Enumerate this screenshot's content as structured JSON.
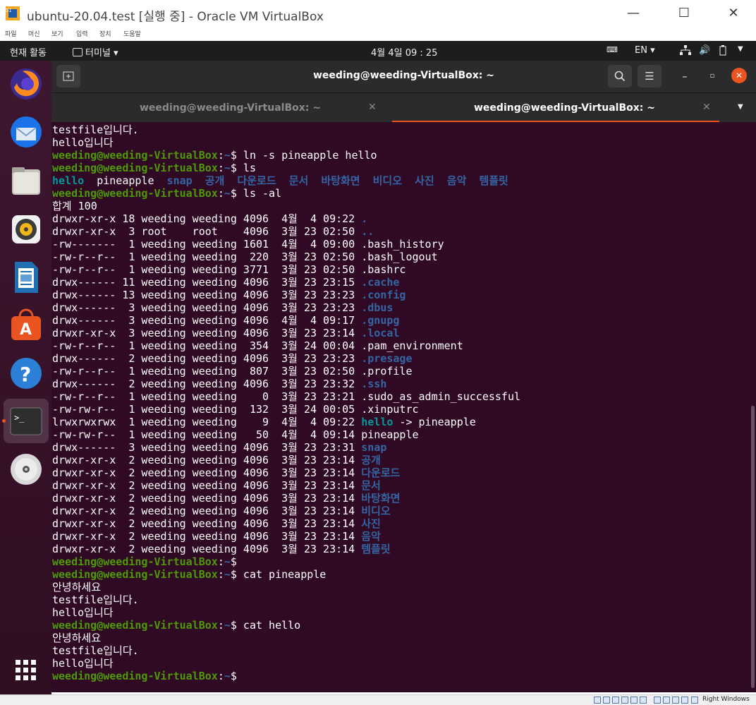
{
  "vbox": {
    "title": "ubuntu-20.04.test [실행 중] - Oracle VM VirtualBox",
    "menu": [
      "파일",
      "머신",
      "보기",
      "입력",
      "장치",
      "도움말"
    ],
    "host_key": "Right Windows"
  },
  "topbar": {
    "activities": "현재 활동",
    "app": "터미널 ▾",
    "clock": "4월 4일  09 : 25",
    "lang": "EN ▾"
  },
  "terminal": {
    "title": "weeding@weeding-VirtualBox: ~",
    "tabs": [
      {
        "label": "weeding@weeding-VirtualBox: ~"
      },
      {
        "label": "weeding@weeding-VirtualBox: ~"
      }
    ],
    "prompt_user": "weeding@weeding-VirtualBox",
    "lines": [
      {
        "t": "testfile입니다."
      },
      {
        "t": "hello입니다"
      },
      {
        "cmd": "ln -s pineapple hello"
      },
      {
        "cmd": "ls"
      },
      {
        "ls": true
      },
      {
        "cmd": "ls -al"
      },
      {
        "t": "합계 100"
      },
      {
        "pre": "drwxr-xr-x 18 weeding weeding 4096  4월  4 09:22 ",
        "name": ".",
        "c": "d"
      },
      {
        "pre": "drwxr-xr-x  3 root    root    4096  3월 23 02:50 ",
        "name": "..",
        "c": "d"
      },
      {
        "pre": "-rw-------  1 weeding weeding 1601  4월  4 09:00 ",
        "name": ".bash_history",
        "c": "p"
      },
      {
        "pre": "-rw-r--r--  1 weeding weeding  220  3월 23 02:50 ",
        "name": ".bash_logout",
        "c": "p"
      },
      {
        "pre": "-rw-r--r--  1 weeding weeding 3771  3월 23 02:50 ",
        "name": ".bashrc",
        "c": "p"
      },
      {
        "pre": "drwx------ 11 weeding weeding 4096  3월 23 23:15 ",
        "name": ".cache",
        "c": "d"
      },
      {
        "pre": "drwx------ 13 weeding weeding 4096  3월 23 23:23 ",
        "name": ".config",
        "c": "d"
      },
      {
        "pre": "drwx------  3 weeding weeding 4096  3월 23 23:23 ",
        "name": ".dbus",
        "c": "d"
      },
      {
        "pre": "drwx------  3 weeding weeding 4096  4월  4 09:17 ",
        "name": ".gnupg",
        "c": "d"
      },
      {
        "pre": "drwxr-xr-x  3 weeding weeding 4096  3월 23 23:14 ",
        "name": ".local",
        "c": "d"
      },
      {
        "pre": "-rw-r--r--  1 weeding weeding  354  3월 24 00:04 ",
        "name": ".pam_environment",
        "c": "p"
      },
      {
        "pre": "drwx------  2 weeding weeding 4096  3월 23 23:23 ",
        "name": ".presage",
        "c": "d"
      },
      {
        "pre": "-rw-r--r--  1 weeding weeding  807  3월 23 02:50 ",
        "name": ".profile",
        "c": "p"
      },
      {
        "pre": "drwx------  2 weeding weeding 4096  3월 23 23:32 ",
        "name": ".ssh",
        "c": "d"
      },
      {
        "pre": "-rw-r--r--  1 weeding weeding    0  3월 23 23:21 ",
        "name": ".sudo_as_admin_successful",
        "c": "p"
      },
      {
        "pre": "-rw-rw-r--  1 weeding weeding  132  3월 24 00:05 ",
        "name": ".xinputrc",
        "c": "p"
      },
      {
        "pre": "lrwxrwxrwx  1 weeding weeding    9  4월  4 09:22 ",
        "name": "hello",
        "c": "l",
        "target": " -> pineapple"
      },
      {
        "pre": "-rw-rw-r--  1 weeding weeding   50  4월  4 09:14 ",
        "name": "pineapple",
        "c": "p"
      },
      {
        "pre": "drwx------  3 weeding weeding 4096  3월 23 23:31 ",
        "name": "snap",
        "c": "d"
      },
      {
        "pre": "drwxr-xr-x  2 weeding weeding 4096  3월 23 23:14 ",
        "name": "공개",
        "c": "d"
      },
      {
        "pre": "drwxr-xr-x  2 weeding weeding 4096  3월 23 23:14 ",
        "name": "다운로드",
        "c": "d"
      },
      {
        "pre": "drwxr-xr-x  2 weeding weeding 4096  3월 23 23:14 ",
        "name": "문서",
        "c": "d"
      },
      {
        "pre": "drwxr-xr-x  2 weeding weeding 4096  3월 23 23:14 ",
        "name": "바탕화면",
        "c": "d"
      },
      {
        "pre": "drwxr-xr-x  2 weeding weeding 4096  3월 23 23:14 ",
        "name": "비디오",
        "c": "d"
      },
      {
        "pre": "drwxr-xr-x  2 weeding weeding 4096  3월 23 23:14 ",
        "name": "사진",
        "c": "d"
      },
      {
        "pre": "drwxr-xr-x  2 weeding weeding 4096  3월 23 23:14 ",
        "name": "음악",
        "c": "d"
      },
      {
        "pre": "drwxr-xr-x  2 weeding weeding 4096  3월 23 23:14 ",
        "name": "템플릿",
        "c": "d"
      },
      {
        "cmd": ""
      },
      {
        "cmd": "cat pineapple"
      },
      {
        "t": "안녕하세요"
      },
      {
        "t": "testfile입니다."
      },
      {
        "t": "hello입니다"
      },
      {
        "cmd": "cat hello"
      },
      {
        "t": "안녕하세요"
      },
      {
        "t": "testfile입니다."
      },
      {
        "t": "hello입니다"
      },
      {
        "cmd": ""
      }
    ],
    "ls_output": [
      {
        "name": "hello",
        "c": "l"
      },
      {
        "name": "pineapple",
        "c": "p"
      },
      {
        "name": "snap",
        "c": "d"
      },
      {
        "name": "공개",
        "c": "d"
      },
      {
        "name": "다운로드",
        "c": "d"
      },
      {
        "name": "문서",
        "c": "d"
      },
      {
        "name": "바탕화면",
        "c": "d"
      },
      {
        "name": "비디오",
        "c": "d"
      },
      {
        "name": "사진",
        "c": "d"
      },
      {
        "name": "음악",
        "c": "d"
      },
      {
        "name": "템플릿",
        "c": "d"
      }
    ]
  },
  "dock": [
    "firefox-icon",
    "thunderbird-icon",
    "files-icon",
    "rhythmbox-icon",
    "writer-icon",
    "software-icon",
    "help-icon",
    "terminal-icon",
    "dvd-icon",
    "show-apps-icon"
  ],
  "colors": {
    "user": "#4e9a06",
    "dir": "#3465a4",
    "link": "#06989a",
    "bg": "#300a24",
    "accent": "#e95420"
  }
}
